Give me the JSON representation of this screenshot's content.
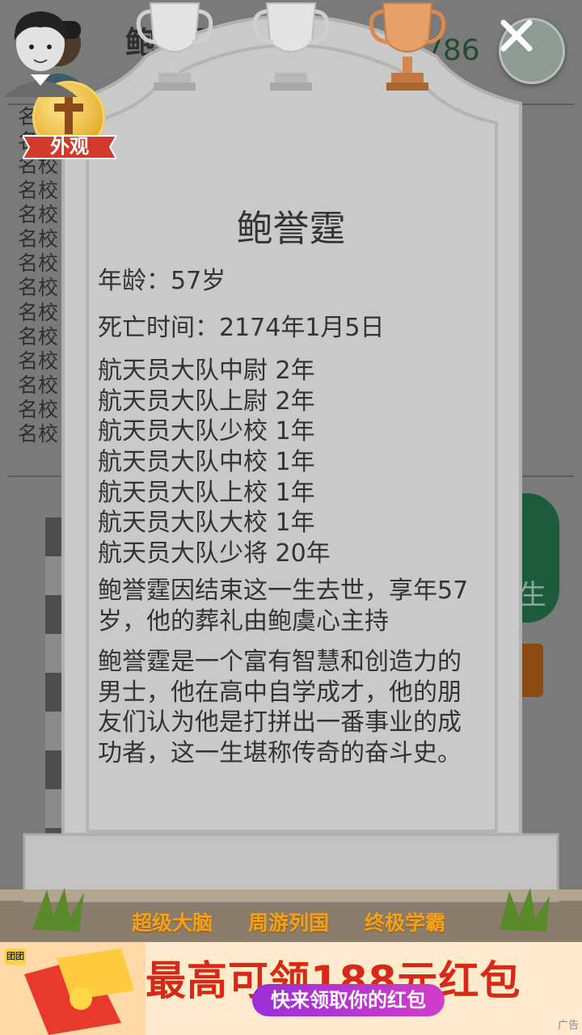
{
  "background": {
    "player_name": "鲍誉霆",
    "score": "786",
    "list_items": [
      "名校",
      "名校",
      "名校",
      "名校",
      "名校",
      "名校",
      "名校",
      "名校",
      "名校",
      "名校",
      "名校",
      "名校",
      "名校",
      "名校"
    ],
    "side_button_char": "生"
  },
  "dialog": {
    "appearance_label": "外观",
    "name": "鲍誉霆",
    "age": "年龄：57岁",
    "death_time": "死亡时间：2174年1月5日",
    "career": [
      "航天员大队中尉 2年",
      "航天员大队上尉 2年",
      "航天员大队少校 1年",
      "航天员大队中校 1年",
      "航天员大队上校 1年",
      "航天员大队大校 1年",
      "航天员大队少将 20年"
    ],
    "death_note": "鲍誉霆因结束这一生去世，享年57岁，他的葬礼由鲍虞心主持",
    "summary": "鲍誉霆是一个富有智慧和创造力的男士，他在高中自学成才，他的朋友们认为他是打拼出一番事业的成功者，这一生堪称传奇的奋斗史。",
    "trophies": [
      {
        "label": "超级大脑",
        "tier": "silver"
      },
      {
        "label": "周游列国",
        "tier": "silver"
      },
      {
        "label": "终极学霸",
        "tier": "bronze"
      }
    ]
  },
  "ad": {
    "brand": "团团",
    "title": "最高可领188元红包",
    "button": "快来领取你的红包",
    "tag": "广告"
  },
  "colors": {
    "stone": "#c9c9c9",
    "stone_edge": "#b3b3b3",
    "trophy_label": "#f2a11c",
    "ad_title": "#d6281c"
  }
}
